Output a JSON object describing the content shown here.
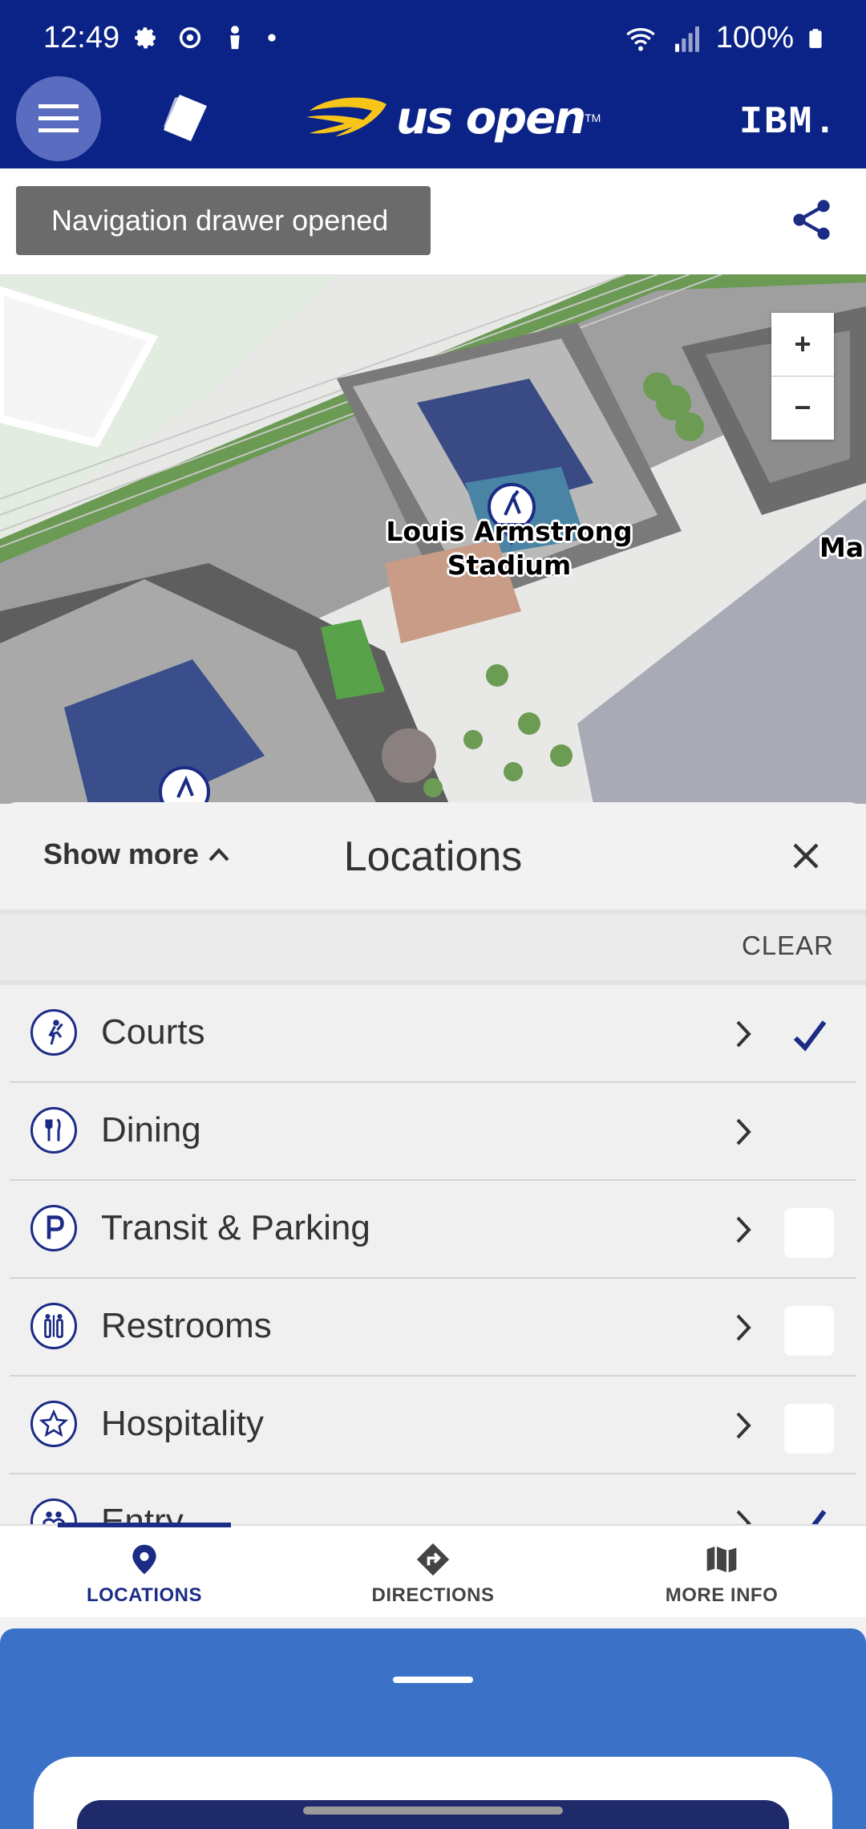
{
  "status_bar": {
    "time": "12:49",
    "battery": "100%"
  },
  "header": {
    "logo_text": "us open",
    "logo_tm": "TM",
    "sponsor": "IBM."
  },
  "toast": {
    "message": "Navigation drawer opened"
  },
  "map": {
    "zoom_in": "+",
    "zoom_out": "−",
    "labels": {
      "stadium_line1": "Louis Armstrong",
      "stadium_line2": "Stadium",
      "edge_label": "Ma"
    }
  },
  "sheet": {
    "show_more": "Show more",
    "title": "Locations",
    "clear": "CLEAR",
    "items": [
      {
        "label": "Courts",
        "checked": true
      },
      {
        "label": "Dining",
        "checked": null
      },
      {
        "label": "Transit & Parking",
        "checked": false
      },
      {
        "label": "Restrooms",
        "checked": false
      },
      {
        "label": "Hospitality",
        "checked": false
      },
      {
        "label": "Entry",
        "checked": true
      }
    ]
  },
  "tabs": [
    {
      "label": "LOCATIONS",
      "icon": "location-pin-icon",
      "active": true
    },
    {
      "label": "DIRECTIONS",
      "icon": "directions-icon",
      "active": false
    },
    {
      "label": "MORE INFO",
      "icon": "map-icon",
      "active": false
    }
  ],
  "colors": {
    "brand_navy": "#0b2386",
    "accent_blue": "#1b2b86",
    "panel_blue": "#3b72c8",
    "logo_yellow": "#f7c51a"
  }
}
